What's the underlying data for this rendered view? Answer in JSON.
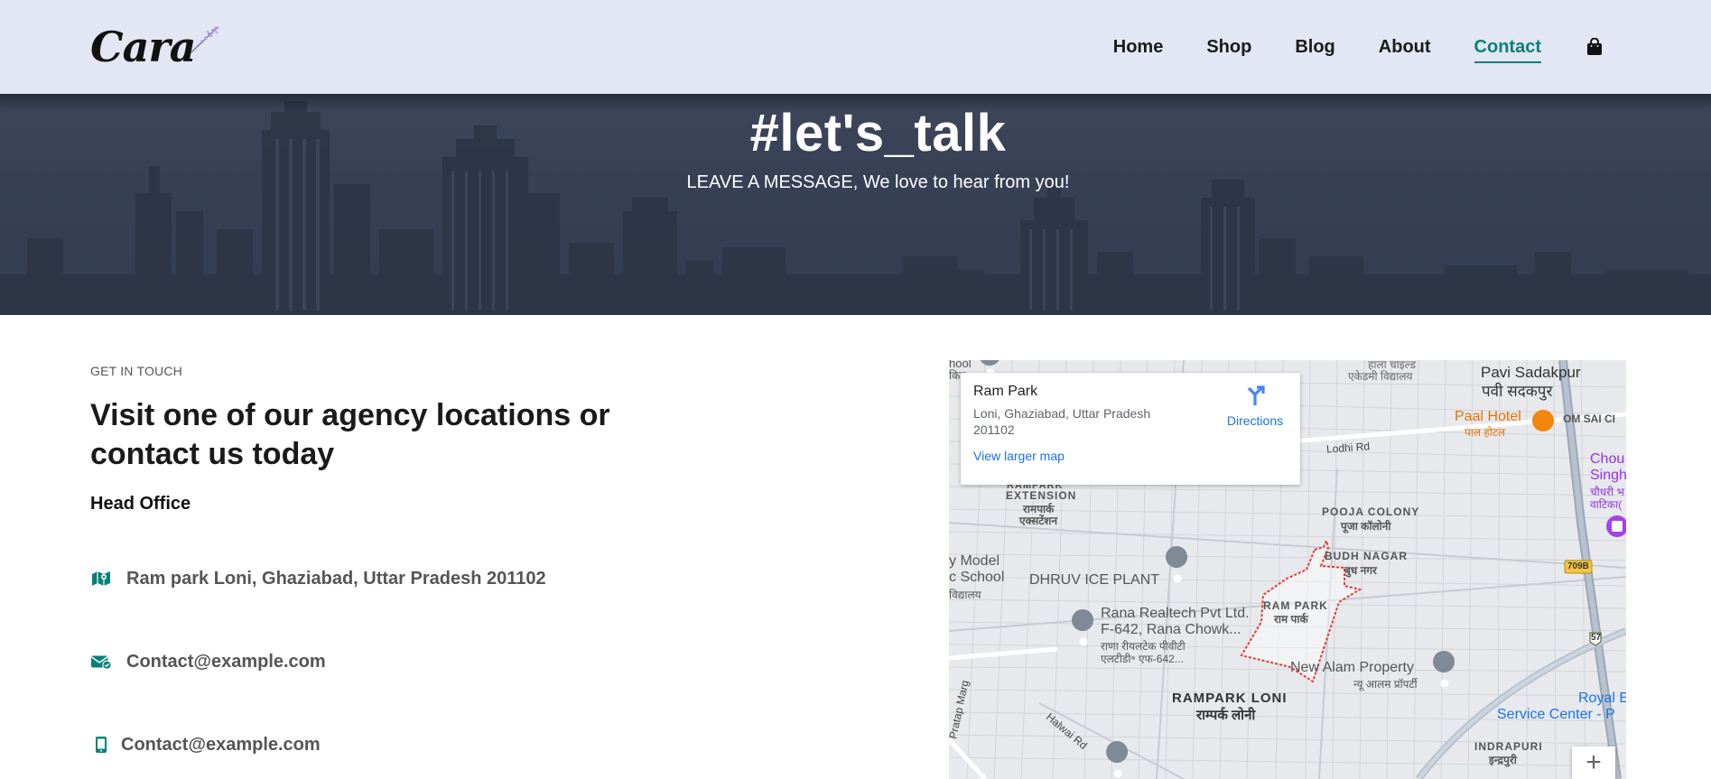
{
  "header": {
    "logo_text": "Cara",
    "nav": [
      {
        "label": "Home"
      },
      {
        "label": "Shop"
      },
      {
        "label": "Blog"
      },
      {
        "label": "About"
      },
      {
        "label": "Contact",
        "active": true
      }
    ],
    "cart_icon": "shopping-bag-icon"
  },
  "hero": {
    "title": "#let's_talk",
    "subtitle": "LEAVE A MESSAGE, We love to hear from you!"
  },
  "details": {
    "eyebrow": "GET IN TOUCH",
    "headline": "Visit one of our agency locations or contact us today",
    "office_heading": "Head Office",
    "items": [
      {
        "icon": "map-icon",
        "text": "Ram park Loni, Ghaziabad, Uttar Pradesh 201102"
      },
      {
        "icon": "envelope-icon",
        "text": "Contact@example.com"
      },
      {
        "icon": "phone-icon",
        "text": "Contact@example.com"
      }
    ]
  },
  "map": {
    "place_title": "Ram Park",
    "place_address": "Loni, Ghaziabad, Uttar Pradesh 201102",
    "directions_label": "Directions",
    "larger_map_link": "View larger map",
    "zoom_in": "+",
    "labels": {
      "pavi_en": "Pavi Sadakpur",
      "pavi_hi": "पवी सदकपुर",
      "paal_en": "Paal Hotel",
      "paal_hi": "पाल होटल",
      "omsai": "OM SAI CI",
      "lodhi": "Lodhi Rd",
      "pooja_en": "POOJA COLONY",
      "pooja_hi": "पूजा कॉलोनी",
      "budh_en": "BUDH NAGAR",
      "budh_hi": "बुध नगर",
      "ext_1": "RAMPARK",
      "ext_2": "EXTENSION",
      "ext_hi_1": "रामपार्क",
      "ext_hi_2": "एक्सटेंशन",
      "school_1": "y Model",
      "school_2": "c School",
      "school_3": "विद्यालय",
      "dhruv": "DHRUV ICE PLANT",
      "rana_1": "Rana Realtech Pvt Ltd.",
      "rana_2": "F-642, Rana Chowk...",
      "rana_3": "राणा रीयलटेक पीवीटी",
      "rana_4": "एलटीडी॰ एफ-642...",
      "rampark_en": "RAM PARK",
      "rampark_hi": "राम पार्क",
      "newalam_en": "New Alam Property",
      "newalam_hi": "न्यू आलम प्रॉपर्टी",
      "rploni_en": "RAMPARK LONI",
      "rploni_hi": "राम्पर्क लोनी",
      "pratap": "Pratap Marg",
      "halwai": "Halwai Rd",
      "indrapuri_en": "INDRAPURI",
      "indrapuri_hi": "इन्द्रपुरी",
      "royal_1": "Royal E",
      "royal_2": "Service Center - P",
      "chou_1": "Chou",
      "chou_2": "Singh",
      "chou_3": "चौधरी भ",
      "chou_4": "वाटिका(",
      "top_hi_1": "हाला चाइल्ड",
      "top_hi_2": "एकेडमी विद्यालय",
      "road_709b": "709B",
      "road_57": "57",
      "left_top": "hool",
      "left_top2": "किड"
    }
  },
  "colors": {
    "accent": "#088178",
    "header_bg": "#e3e6f3",
    "hero_bg": "#374055",
    "map_link": "#1a73e8"
  }
}
